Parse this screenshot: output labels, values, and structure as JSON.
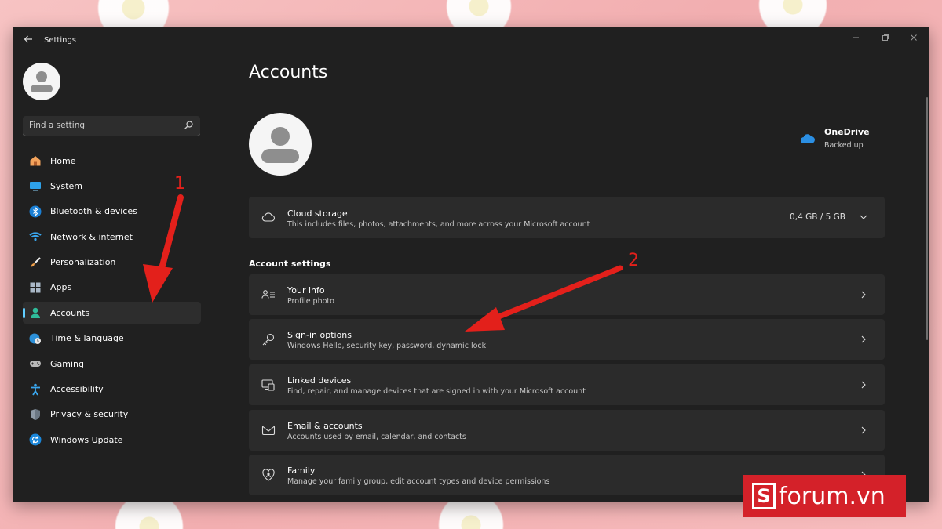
{
  "window": {
    "app_title": "Settings"
  },
  "sidebar": {
    "search_placeholder": "Find a setting",
    "items": [
      {
        "label": "Home",
        "icon": "home-icon"
      },
      {
        "label": "System",
        "icon": "system-icon"
      },
      {
        "label": "Bluetooth & devices",
        "icon": "bluetooth-icon"
      },
      {
        "label": "Network & internet",
        "icon": "wifi-icon"
      },
      {
        "label": "Personalization",
        "icon": "brush-icon"
      },
      {
        "label": "Apps",
        "icon": "apps-icon"
      },
      {
        "label": "Accounts",
        "icon": "person-icon",
        "selected": true
      },
      {
        "label": "Time & language",
        "icon": "globe-clock-icon"
      },
      {
        "label": "Gaming",
        "icon": "gamepad-icon"
      },
      {
        "label": "Accessibility",
        "icon": "accessibility-icon"
      },
      {
        "label": "Privacy & security",
        "icon": "shield-icon"
      },
      {
        "label": "Windows Update",
        "icon": "update-icon"
      }
    ]
  },
  "main": {
    "title": "Accounts",
    "onedrive": {
      "title": "OneDrive",
      "status": "Backed up"
    },
    "cloud_storage": {
      "title": "Cloud storage",
      "subtitle": "This includes files, photos, attachments, and more across your Microsoft account",
      "value": "0,4 GB / 5 GB"
    },
    "section_label": "Account settings",
    "settings": [
      {
        "title": "Your info",
        "subtitle": "Profile photo",
        "icon": "person-list-icon"
      },
      {
        "title": "Sign-in options",
        "subtitle": "Windows Hello, security key, password, dynamic lock",
        "icon": "key-icon"
      },
      {
        "title": "Linked devices",
        "subtitle": "Find, repair, and manage devices that are signed in with your Microsoft account",
        "icon": "devices-icon"
      },
      {
        "title": "Email & accounts",
        "subtitle": "Accounts used by email, calendar, and contacts",
        "icon": "mail-icon"
      },
      {
        "title": "Family",
        "subtitle": "Manage your family group, edit account types and device permissions",
        "icon": "family-heart-icon"
      }
    ]
  },
  "annotations": {
    "marker_1": "1",
    "marker_2": "2",
    "color": "#e3201b"
  },
  "watermark": {
    "text": "forum.vn",
    "color": "#d42129"
  },
  "colors": {
    "accent": "#60cdff",
    "window_bg": "#202020",
    "card_bg": "#2b2b2b"
  }
}
